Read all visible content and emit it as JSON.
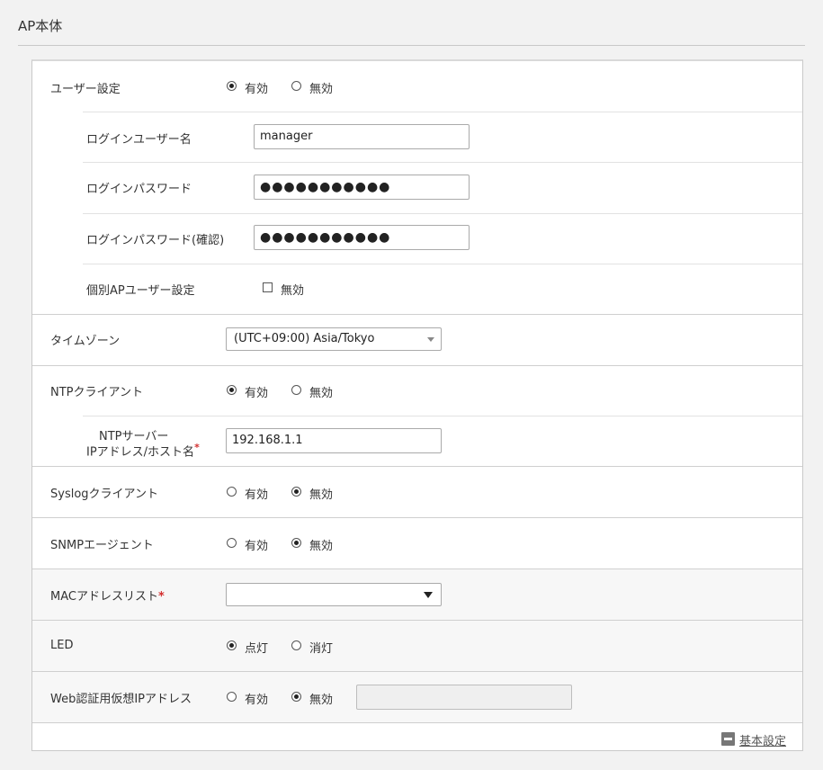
{
  "page": {
    "title": "AP本体"
  },
  "user_settings": {
    "label": "ユーザー設定",
    "enabled_label": "有効",
    "disabled_label": "無効",
    "selected": "enabled",
    "login_user": {
      "label": "ログインユーザー名",
      "value": "manager"
    },
    "login_password": {
      "label": "ログインパスワード",
      "value": "●●●●●●●●●●●"
    },
    "login_password_confirm": {
      "label": "ログインパスワード(確認)",
      "value": "●●●●●●●●●●●"
    },
    "individual_ap_user": {
      "label": "個別APユーザー設定",
      "checkbox_label": "無効",
      "checked": false
    }
  },
  "timezone": {
    "label": "タイムゾーン",
    "value": "(UTC+09:00) Asia/Tokyo"
  },
  "ntp_client": {
    "label": "NTPクライアント",
    "enabled_label": "有効",
    "disabled_label": "無効",
    "selected": "enabled",
    "server": {
      "label_line1": "NTPサーバー",
      "label_line2": "IPアドレス/ホスト名",
      "required_mark": "*",
      "value": "192.168.1.1"
    }
  },
  "syslog_client": {
    "label": "Syslogクライアント",
    "enabled_label": "有効",
    "disabled_label": "無効",
    "selected": "disabled"
  },
  "snmp_agent": {
    "label": "SNMPエージェント",
    "enabled_label": "有効",
    "disabled_label": "無効",
    "selected": "disabled"
  },
  "mac_list": {
    "label": "MACアドレスリスト",
    "required_mark": "*",
    "value": ""
  },
  "led": {
    "label": "LED",
    "on_label": "点灯",
    "off_label": "消灯",
    "selected": "on"
  },
  "web_auth_ip": {
    "label": "Web認証用仮想IPアドレス",
    "enabled_label": "有効",
    "disabled_label": "無効",
    "selected": "disabled",
    "value": ""
  },
  "footer": {
    "basic_settings_link": "基本設定"
  }
}
